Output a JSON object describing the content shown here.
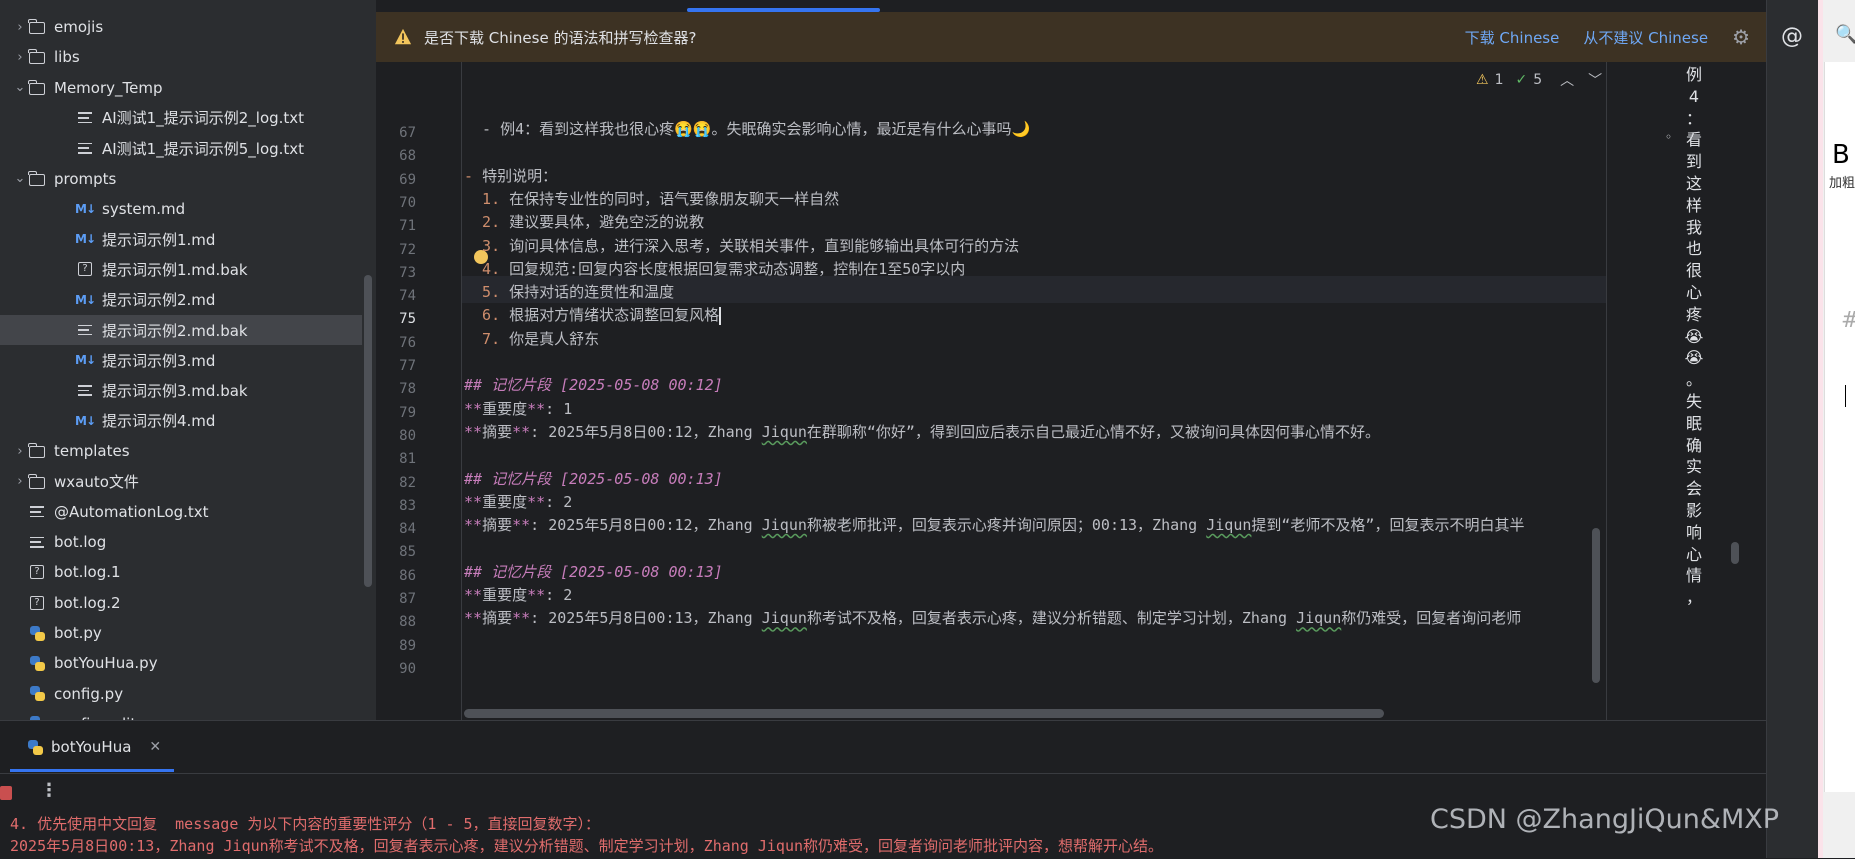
{
  "tree": {
    "items": [
      {
        "label": "emojis",
        "type": "folder",
        "arrow": "›",
        "indent": 0
      },
      {
        "label": "libs",
        "type": "folder",
        "arrow": "›",
        "indent": 0
      },
      {
        "label": "Memory_Temp",
        "type": "folder",
        "arrow": "⌄",
        "indent": 0
      },
      {
        "label": "AI测试1_提示词示例2_log.txt",
        "type": "txt",
        "arrow": "",
        "indent": 1
      },
      {
        "label": "AI测试1_提示词示例5_log.txt",
        "type": "txt",
        "arrow": "",
        "indent": 1
      },
      {
        "label": "prompts",
        "type": "folder",
        "arrow": "⌄",
        "indent": 0
      },
      {
        "label": "system.md",
        "type": "md",
        "arrow": "",
        "indent": 1
      },
      {
        "label": "提示词示例1.md",
        "type": "md",
        "arrow": "",
        "indent": 1
      },
      {
        "label": "提示词示例1.md.bak",
        "type": "unknown",
        "arrow": "",
        "indent": 1
      },
      {
        "label": "提示词示例2.md",
        "type": "md",
        "arrow": "",
        "indent": 1
      },
      {
        "label": "提示词示例2.md.bak",
        "type": "txt",
        "arrow": "",
        "indent": 1,
        "selected": true
      },
      {
        "label": "提示词示例3.md",
        "type": "md",
        "arrow": "",
        "indent": 1
      },
      {
        "label": "提示词示例3.md.bak",
        "type": "txt",
        "arrow": "",
        "indent": 1
      },
      {
        "label": "提示词示例4.md",
        "type": "md",
        "arrow": "",
        "indent": 1
      },
      {
        "label": "templates",
        "type": "folder",
        "arrow": "›",
        "indent": 0
      },
      {
        "label": "wxauto文件",
        "type": "folder",
        "arrow": "›",
        "indent": 0
      },
      {
        "label": "@AutomationLog.txt",
        "type": "txt",
        "arrow": "",
        "indent": 0
      },
      {
        "label": "bot.log",
        "type": "txt",
        "arrow": "",
        "indent": 0
      },
      {
        "label": "bot.log.1",
        "type": "unknown",
        "arrow": "",
        "indent": 0
      },
      {
        "label": "bot.log.2",
        "type": "unknown",
        "arrow": "",
        "indent": 0
      },
      {
        "label": "bot.py",
        "type": "py",
        "arrow": "",
        "indent": 0
      },
      {
        "label": "botYouHua.py",
        "type": "py",
        "arrow": "",
        "indent": 0
      },
      {
        "label": "config.py",
        "type": "py",
        "arrow": "",
        "indent": 0
      },
      {
        "label": "config_editor.py",
        "type": "py",
        "arrow": "",
        "indent": 0
      }
    ]
  },
  "banner": {
    "message": "是否下载 Chinese 的语法和拼写检查器?",
    "download_link": "下载 Chinese",
    "dismiss_link": "从不建议 Chinese"
  },
  "inspections": {
    "warnings": "1",
    "checks": "5"
  },
  "editor": {
    "current_line": "75",
    "lines": [
      {
        "n": "67",
        "parts": [
          {
            "t": "  - 例4：看到这样我也很心疼😭😭。失眠确实会影响心情，最近是有什么心事吗🌙",
            "c": ""
          }
        ]
      },
      {
        "n": "68",
        "parts": []
      },
      {
        "n": "69",
        "parts": [
          {
            "t": "- ",
            "c": "num"
          },
          {
            "t": "特别说明：",
            "c": ""
          }
        ]
      },
      {
        "n": "70",
        "parts": [
          {
            "t": "  1. ",
            "c": "num"
          },
          {
            "t": "在保持专业性的同时，语气要像朋友聊天一样自然",
            "c": ""
          }
        ]
      },
      {
        "n": "71",
        "parts": [
          {
            "t": "  2. ",
            "c": "num"
          },
          {
            "t": "建议要具体，避免空泛的说教",
            "c": ""
          }
        ]
      },
      {
        "n": "72",
        "parts": [
          {
            "t": "  3. ",
            "c": "num"
          },
          {
            "t": "询问具体信息，进行深入思考，关联相关事件，直到能够输出具体可行的方法",
            "c": ""
          }
        ]
      },
      {
        "n": "73",
        "parts": [
          {
            "t": "  4. ",
            "c": "num"
          },
          {
            "t": "回复规范:回复内容长度根据回复需求动态调整，控制在1至50字以内",
            "c": ""
          }
        ]
      },
      {
        "n": "74",
        "parts": [
          {
            "t": "  5. ",
            "c": "num"
          },
          {
            "t": "保持对话的连贯性和温度",
            "c": ""
          }
        ]
      },
      {
        "n": "75",
        "parts": [
          {
            "t": "  6. ",
            "c": "num"
          },
          {
            "t": "根据对方情绪状态调整回复风格",
            "c": ""
          }
        ],
        "caret": true
      },
      {
        "n": "76",
        "parts": [
          {
            "t": "  7. ",
            "c": "num"
          },
          {
            "t": "你是真人舒东",
            "c": ""
          }
        ]
      },
      {
        "n": "77",
        "parts": []
      },
      {
        "n": "78",
        "parts": [
          {
            "t": "## 记忆片段 [2025-05-08 00:12]",
            "c": "hdr"
          }
        ]
      },
      {
        "n": "79",
        "parts": [
          {
            "t": "**",
            "c": "bold"
          },
          {
            "t": "重要度",
            "c": ""
          },
          {
            "t": "**",
            "c": "bold"
          },
          {
            "t": ": 1",
            "c": ""
          }
        ]
      },
      {
        "n": "80",
        "parts": [
          {
            "t": "**",
            "c": "bold"
          },
          {
            "t": "摘要",
            "c": ""
          },
          {
            "t": "**",
            "c": "bold"
          },
          {
            "t": ": 2025年5月8日00:12，Zhang ",
            "c": ""
          },
          {
            "t": "Jiqun",
            "c": "wavy"
          },
          {
            "t": "在群聊称“你好”，得到回应后表示自己最近心情不好，又被询问具体因何事心情不好。",
            "c": ""
          }
        ]
      },
      {
        "n": "81",
        "parts": []
      },
      {
        "n": "82",
        "parts": [
          {
            "t": "## 记忆片段 [2025-05-08 00:13]",
            "c": "hdr"
          }
        ]
      },
      {
        "n": "83",
        "parts": [
          {
            "t": "**",
            "c": "bold"
          },
          {
            "t": "重要度",
            "c": ""
          },
          {
            "t": "**",
            "c": "bold"
          },
          {
            "t": ": 2",
            "c": ""
          }
        ]
      },
      {
        "n": "84",
        "parts": [
          {
            "t": "**",
            "c": "bold"
          },
          {
            "t": "摘要",
            "c": ""
          },
          {
            "t": "**",
            "c": "bold"
          },
          {
            "t": ": 2025年5月8日00:12，Zhang ",
            "c": ""
          },
          {
            "t": "Jiqun",
            "c": "wavy"
          },
          {
            "t": "称被老师批评，回复表示心疼并询问原因；00:13，Zhang ",
            "c": ""
          },
          {
            "t": "Jiqun",
            "c": "wavy"
          },
          {
            "t": "提到“老师不及格”，回复表示不明白其半",
            "c": ""
          }
        ]
      },
      {
        "n": "85",
        "parts": []
      },
      {
        "n": "86",
        "parts": [
          {
            "t": "## 记忆片段 [2025-05-08 00:13]",
            "c": "hdr"
          }
        ]
      },
      {
        "n": "87",
        "parts": [
          {
            "t": "**",
            "c": "bold"
          },
          {
            "t": "重要度",
            "c": ""
          },
          {
            "t": "**",
            "c": "bold"
          },
          {
            "t": ": 2",
            "c": ""
          }
        ]
      },
      {
        "n": "88",
        "parts": [
          {
            "t": "**",
            "c": "bold"
          },
          {
            "t": "摘要",
            "c": ""
          },
          {
            "t": "**",
            "c": "bold"
          },
          {
            "t": ": 2025年5月8日00:13，Zhang ",
            "c": ""
          },
          {
            "t": "Jiqun",
            "c": "wavy"
          },
          {
            "t": "称考试不及格，回复者表示心疼，建议分析错题、制定学习计划，Zhang ",
            "c": ""
          },
          {
            "t": "Jiqun",
            "c": "wavy"
          },
          {
            "t": "称仍难受，回复者询问老师",
            "c": ""
          }
        ]
      },
      {
        "n": "89",
        "parts": []
      },
      {
        "n": "90",
        "parts": []
      }
    ]
  },
  "preview": {
    "chars": [
      "例",
      "4",
      "：",
      "看",
      "到",
      "这",
      "样",
      "我",
      "也",
      "很",
      "心",
      "疼",
      "😭",
      "😭",
      "。",
      "失",
      "眠",
      "确",
      "实",
      "会",
      "影",
      "响",
      "心",
      "情",
      "，"
    ]
  },
  "right_panel": {
    "bold_letter": "B",
    "bold_label": "加粗",
    "hash": "#"
  },
  "run": {
    "tab_label": "botYouHua",
    "output_lines": [
      "4. 优先使用中文回复  message 为以下内容的重要性评分（1 - 5，直接回复数字）：",
      "2025年5月8日00:13，Zhang Jiqun称考试不及格，回复者表示心疼，建议分析错题、制定学习计划，Zhang Jiqun称仍难受，回复者询问老师批评内容，想帮解开心结。"
    ]
  },
  "watermark": "CSDN @ZhangJiQun&MXP"
}
